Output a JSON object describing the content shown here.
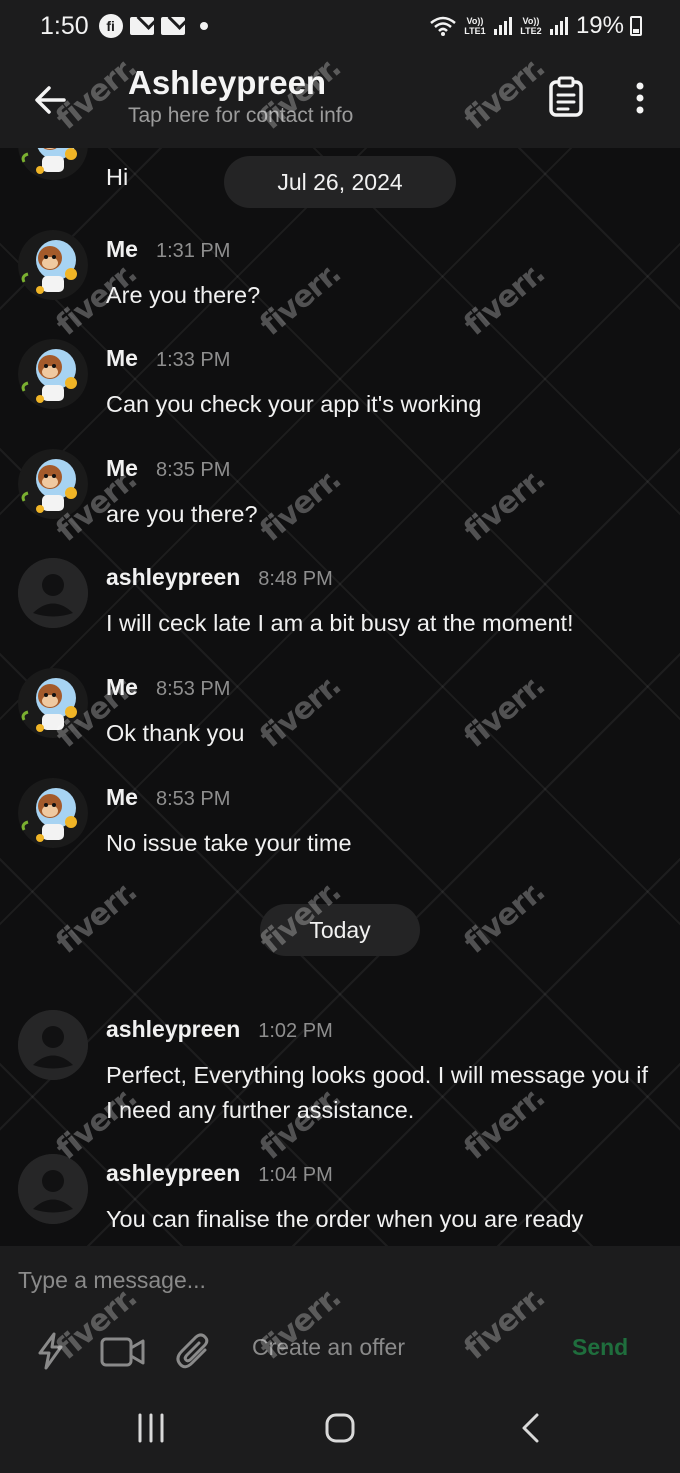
{
  "status_bar": {
    "time": "1:50",
    "notification_icons": [
      "fiverr-app-icon",
      "mail-icon",
      "mail-icon",
      "dot-icon"
    ],
    "sim1_label": "Vo)) LTE1",
    "sim2_label": "Vo)) LTE2",
    "battery": "19%"
  },
  "header": {
    "title": "Ashleypreen",
    "subtitle": "Tap here for contact info"
  },
  "date_separators": [
    "Jul 26, 2024",
    "Today"
  ],
  "messages": [
    {
      "sender": "",
      "time": "",
      "text": "Hi",
      "avatar": "monkey-astronaut"
    },
    {
      "sender": "Me",
      "time": "1:31 PM",
      "text": "Are you there?",
      "avatar": "monkey-astronaut"
    },
    {
      "sender": "Me",
      "time": "1:33 PM",
      "text": "Can you check your app it's working",
      "avatar": "monkey-astronaut"
    },
    {
      "sender": "Me",
      "time": "8:35 PM",
      "text": "are you there?",
      "avatar": "monkey-astronaut"
    },
    {
      "sender": "ashleypreen",
      "time": "8:48 PM",
      "text": "I will ceck late I am a bit busy at the moment!",
      "avatar": "default-user"
    },
    {
      "sender": "Me",
      "time": "8:53 PM",
      "text": "Ok thank you",
      "avatar": "monkey-astronaut"
    },
    {
      "sender": "Me",
      "time": "8:53 PM",
      "text": "No issue take your time",
      "avatar": "monkey-astronaut"
    },
    {
      "sender": "ashleypreen",
      "time": "1:02 PM",
      "text": "Perfect, Everything looks good. I will message you if I need any further assistance.",
      "avatar": "default-user"
    },
    {
      "sender": "ashleypreen",
      "time": "1:04 PM",
      "text": "You can finalise the order when you are ready",
      "avatar": "default-user"
    }
  ],
  "composer": {
    "placeholder": "Type a message...",
    "offer_label": "Create an offer",
    "send_label": "Send"
  },
  "watermark": "fiverr.",
  "colors": {
    "background": "#0f0f10",
    "bar_background": "#1c1c1d",
    "pill_background": "#242425",
    "send_green": "#1f6e3d",
    "muted_text": "#8e8e8e"
  }
}
